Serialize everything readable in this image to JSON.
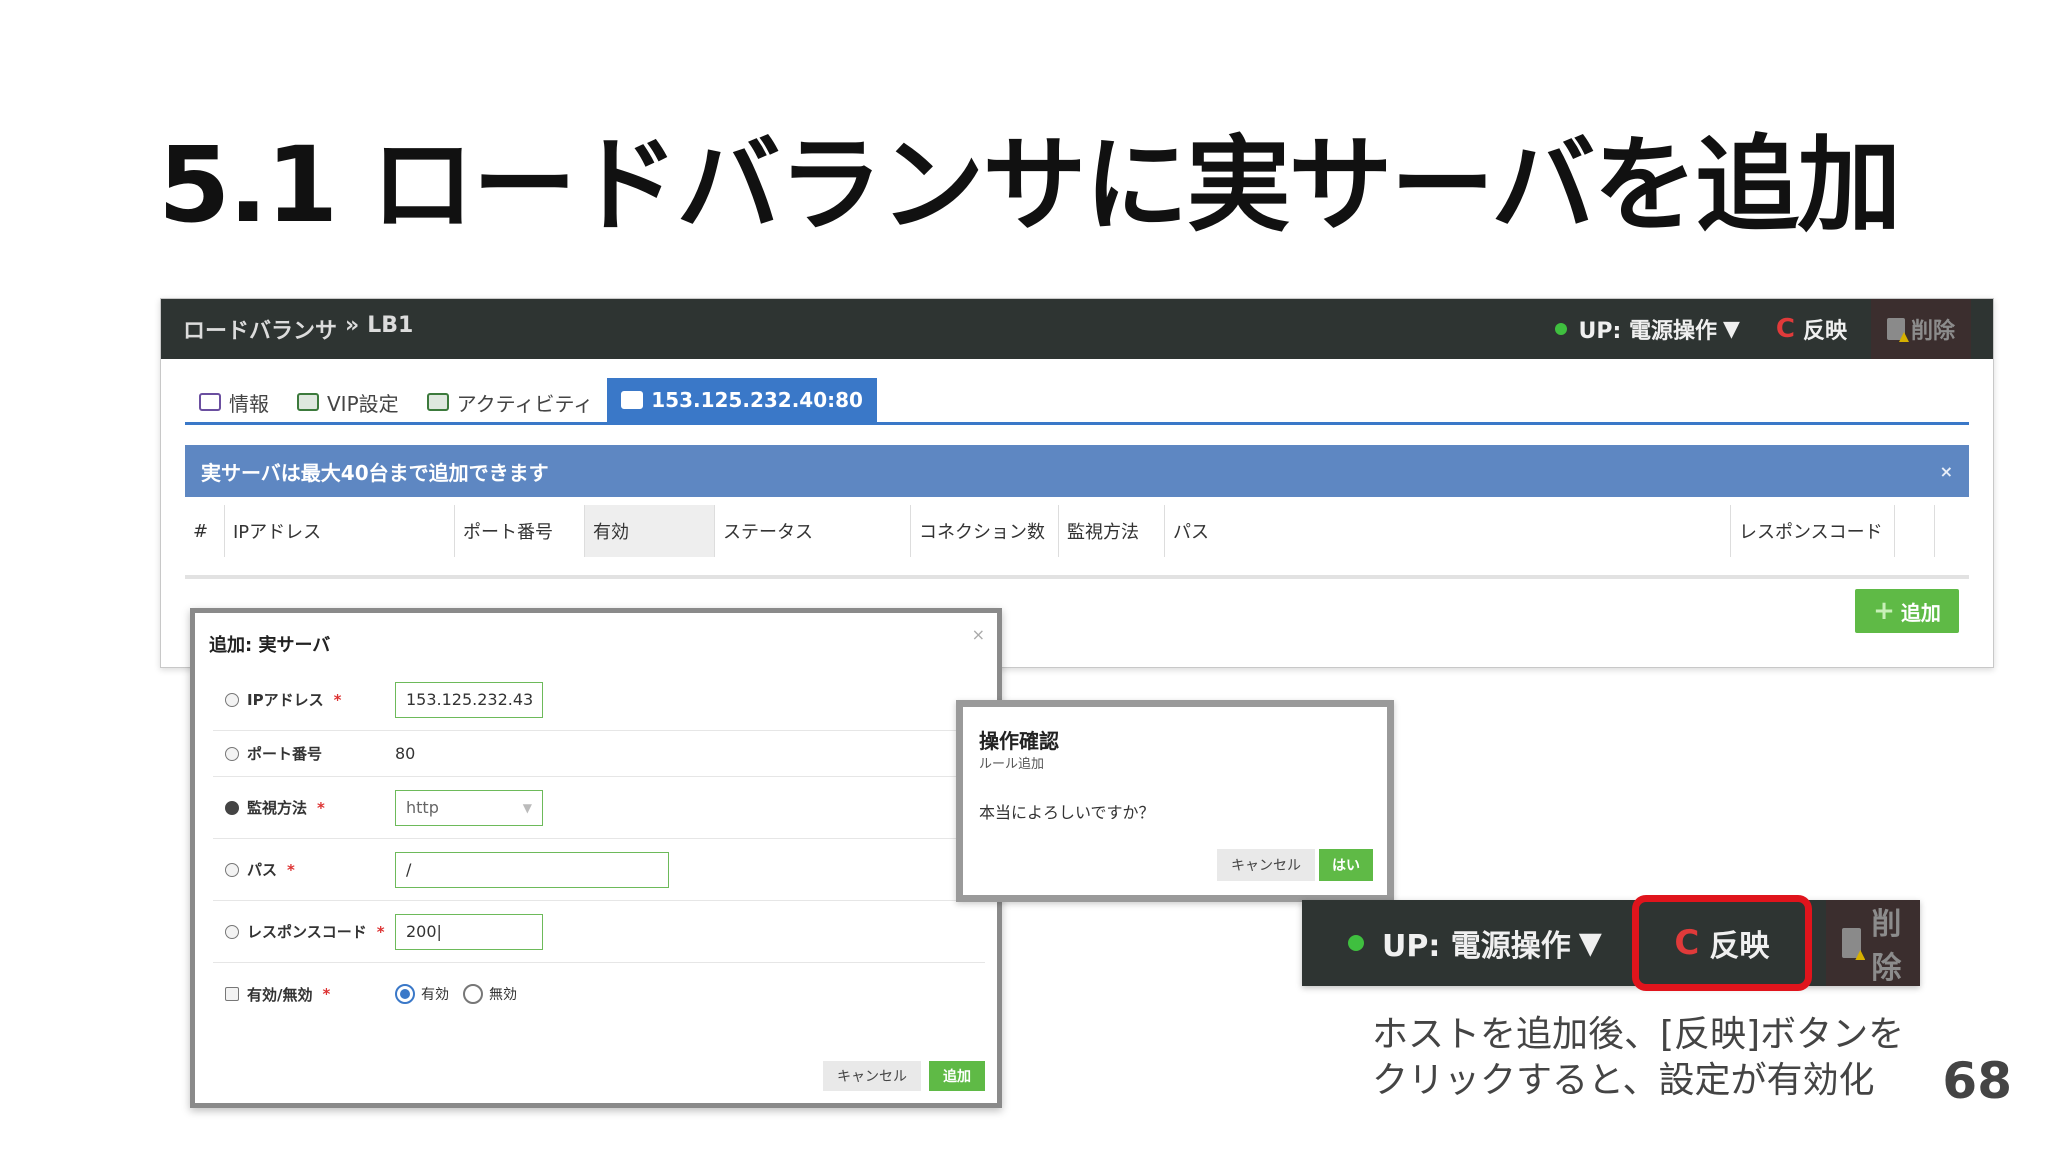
{
  "slide": {
    "title": "5.1 ロードバランサに実サーバを追加",
    "page_number": "68",
    "note_line1": "ホストを追加後、[反映]ボタンを",
    "note_line2": "クリックすると、設定が有効化"
  },
  "header": {
    "breadcrumb_root": "ロードバランサ",
    "breadcrumb_sep": "»",
    "breadcrumb_current": "LB1",
    "power_label": "UP: 電源操作",
    "power_caret": "▼",
    "reflect_icon_glyph": "C",
    "reflect_label": "反映",
    "delete_label": "削除"
  },
  "tabs": [
    {
      "label": "情報"
    },
    {
      "label": "VIP設定"
    },
    {
      "label": "アクティビティ"
    },
    {
      "label": "153.125.232.40:80"
    }
  ],
  "info_bar": {
    "message": "実サーバは最大40台まで追加できます",
    "close": "×"
  },
  "table": {
    "columns": [
      "#",
      "IPアドレス",
      "ポート番号",
      "有効",
      "ステータス",
      "コネクション数",
      "監視方法",
      "パス",
      "レスポンスコード"
    ]
  },
  "add_button": {
    "icon": "+",
    "label": "追加"
  },
  "add_dialog": {
    "title": "追加: 実サーバ",
    "close": "×",
    "fields": {
      "ip_label": "IPアドレス",
      "ip_value": "153.125.232.43",
      "port_label": "ポート番号",
      "port_value": "80",
      "method_label": "監視方法",
      "method_value": "http",
      "path_label": "パス",
      "path_value": "/",
      "code_label": "レスポンスコード",
      "code_value": "200|",
      "enable_label": "有効/無効",
      "enable_on": "有効",
      "enable_off": "無効"
    },
    "required_mark": "*",
    "cancel_label": "キャンセル",
    "submit_label": "追加"
  },
  "confirm_dialog": {
    "title": "操作確認",
    "subtitle": "ルール追加",
    "message": "本当によろしいですか？",
    "cancel_label": "キャンセル",
    "yes_label": "はい"
  },
  "zoom_bar": {
    "power_label": "UP: 電源操作",
    "power_caret": "▼",
    "reflect_label": "反映",
    "delete_label": "削除"
  },
  "colors": {
    "header_bg": "#2e3432",
    "accent_blue": "#3a78c8",
    "info_bar": "#5e87c2",
    "success_green": "#5fba46",
    "highlight_red": "#e0141c"
  }
}
